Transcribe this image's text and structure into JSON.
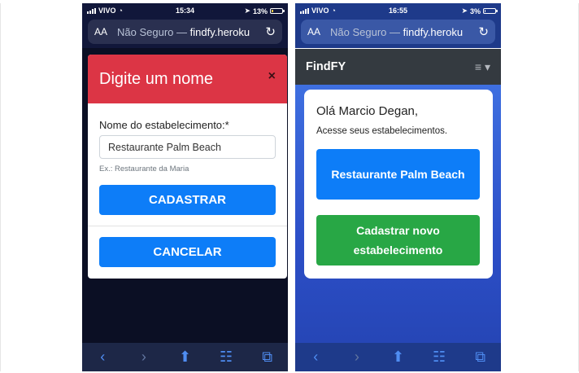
{
  "left_screen": {
    "status": {
      "carrier": "VIVO",
      "time": "15:34",
      "battery": "13%"
    },
    "browser": {
      "aa": "AA",
      "url_prefix": "Não Seguro — ",
      "url_host": "findfy.heroku"
    },
    "modal": {
      "title": "Digite um nome",
      "close": "×",
      "field_label": "Nome do estabelecimento:*",
      "field_value": "Restaurante Palm Beach",
      "field_help": "Ex.: Restaurante da Maria",
      "submit_label": "CADASTRAR",
      "cancel_label": "CANCELAR"
    }
  },
  "right_screen": {
    "status": {
      "carrier": "VIVO",
      "time": "16:55",
      "battery": "3%"
    },
    "browser": {
      "aa": "AA",
      "url_prefix": "Não Seguro — ",
      "url_host": "findfy.heroku"
    },
    "navbar": {
      "brand": "FindFY",
      "menu": "≡ ▾"
    },
    "card": {
      "greeting": "Olá Marcio Degan,",
      "subtitle": "Acesse seus estabelecimentos.",
      "establishment_button": "Restaurante Palm Beach",
      "new_button": "Cadastrar novo estabelecimento"
    }
  },
  "toolbar_icons": [
    "back-icon",
    "forward-icon",
    "share-icon",
    "bookmarks-icon",
    "tabs-icon"
  ],
  "colors": {
    "danger": "#dc3545",
    "primary": "#0d7df8",
    "success": "#28a745",
    "navbar": "#343a40"
  }
}
